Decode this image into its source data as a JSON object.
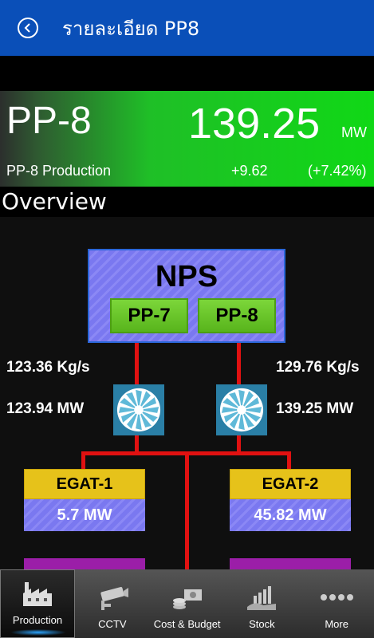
{
  "header": {
    "title": "รายละเอียด PP8"
  },
  "summary": {
    "name": "PP-8",
    "value": "139.25",
    "unit": "MW",
    "subtitle": "PP-8 Production",
    "change": "+9.62",
    "change_pct": "(+7.42%)"
  },
  "overview": {
    "title": "Overview",
    "nps": {
      "label": "NPS",
      "pp7": "PP-7",
      "pp8": "PP-8"
    },
    "left": {
      "flow": "123.36 Kg/s",
      "power": "123.94 MW"
    },
    "right": {
      "flow": "129.76 Kg/s",
      "power": "139.25 MW"
    },
    "egat1": {
      "label": "EGAT-1",
      "value": "5.7 MW"
    },
    "egat2": {
      "label": "EGAT-2",
      "value": "45.82 MW"
    }
  },
  "nav": {
    "items": [
      {
        "label": "Production",
        "icon": "factory-icon"
      },
      {
        "label": "CCTV",
        "icon": "camera-icon"
      },
      {
        "label": "Cost & Budget",
        "icon": "money-icon"
      },
      {
        "label": "Stock",
        "icon": "stock-chart-icon"
      },
      {
        "label": "More",
        "icon": "more-dots-icon"
      }
    ]
  },
  "colors": {
    "appbar": "#0a4fb8",
    "summary_green": "#10d816",
    "wire_red": "#e01111",
    "egat_yellow": "#e6c21a",
    "nps_purple": "#7a78f0",
    "pp_green": "#58b41c"
  }
}
